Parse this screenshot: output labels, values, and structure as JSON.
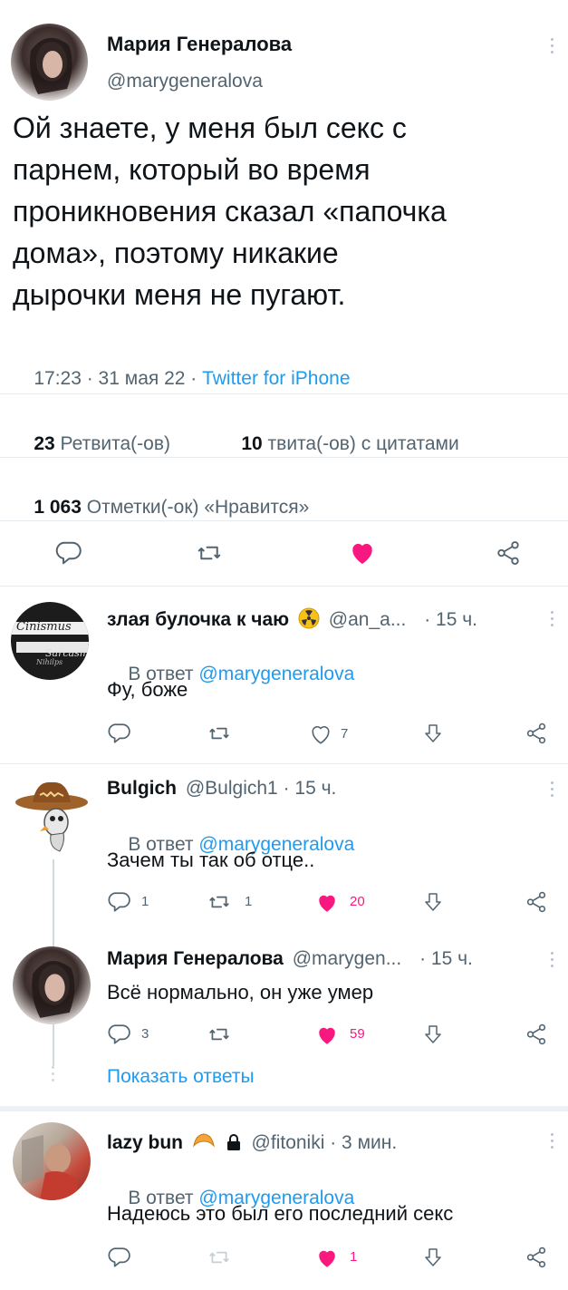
{
  "main_tweet": {
    "author_name": "Мария Генералова",
    "handle": "@marygeneralova",
    "text_lines": [
      "Ой знаете, у меня был секс с",
      "парнем, который во время",
      "проникновения сказал «папочка",
      "дома», поэтому никакие",
      "дырочки меня не пугают."
    ],
    "time": "17:23 · 31 мая 22 · ",
    "source": "Twitter for iPhone",
    "retweets_count": "23",
    "retweets_label": "Ретвита(-ов)",
    "quotes_count": "10",
    "quotes_label": "твита(-ов) с цитатами",
    "likes_count": "1 063",
    "likes_label": "Отметки(-ок) «Нравится»"
  },
  "replies": [
    {
      "author_name": "злая булочка к чаю",
      "handle": "@an_a...",
      "time": "· 15 ч.",
      "reply_to_prefix": "В ответ ",
      "reply_to": "@marygeneralova",
      "text": "Фу, боже",
      "avatar_label_top": "Cinismus",
      "avatar_label_mid": "Sarcasm",
      "avatar_label_bot": "Nihilps",
      "likes": "7"
    },
    {
      "author_name": "Bulgich",
      "handle": "@Bulgich1",
      "time": "· 15 ч.",
      "reply_to_prefix": "В ответ ",
      "reply_to": "@marygeneralova",
      "text": "Зачем ты так об отце..",
      "comments": "1",
      "retweets": "1",
      "likes": "20"
    },
    {
      "author_name": "Мария Генералова",
      "handle": "@marygen...",
      "time": "· 15 ч.",
      "text": "Всё нормально, он уже умер",
      "comments": "3",
      "likes": "59",
      "show_replies": "Показать ответы"
    },
    {
      "author_name": "lazy bun",
      "handle": "@fitoniki",
      "time": "· 3 мин.",
      "reply_to_prefix": "В ответ ",
      "reply_to": "@marygeneralova",
      "text": "Надеюсь это был его последний секс",
      "likes": "1"
    }
  ],
  "colors": {
    "like_active": "#f91880",
    "link": "#1d9bf0",
    "secondary_text": "#536471"
  }
}
